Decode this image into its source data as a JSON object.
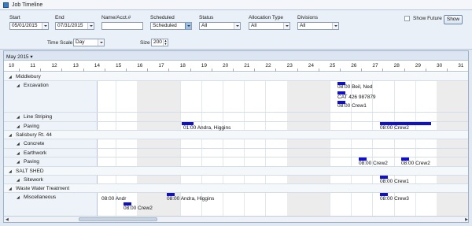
{
  "window": {
    "title": "Job Timeline"
  },
  "filters": {
    "start_label": "Start",
    "start_value": "05/01/2015",
    "end_label": "End",
    "end_value": "07/31/2015",
    "name_label": "Name/Acct.#",
    "name_value": "",
    "scheduled_label": "Scheduled",
    "scheduled_value": "Scheduled",
    "status_label": "Status",
    "status_value": "All",
    "allocation_label": "Allocation Type",
    "allocation_value": "All",
    "divisions_label": "Divisions",
    "divisions_value": "All",
    "show_future_label": "Show Future",
    "show_button": "Show",
    "timescale_label": "Time Scale",
    "timescale_value": "Day",
    "size_label": "Size",
    "size_value": "200"
  },
  "timeline": {
    "month_label": "May 2015",
    "days": [
      "10",
      "11",
      "12",
      "13",
      "14",
      "15",
      "16",
      "17",
      "18",
      "19",
      "20",
      "21",
      "22",
      "23",
      "24",
      "25",
      "26",
      "27",
      "28",
      "29",
      "30",
      "31"
    ],
    "weekend_days": [
      "16",
      "17",
      "23",
      "24",
      "30",
      "31"
    ],
    "rows": [
      {
        "type": "group",
        "label": "Middlebury"
      },
      {
        "type": "task",
        "label": "Excavation",
        "tall": true
      },
      {
        "type": "task",
        "label": "Line Striping"
      },
      {
        "type": "task",
        "label": "Paving"
      },
      {
        "type": "group",
        "label": "Salisbury Rt. 44"
      },
      {
        "type": "task",
        "label": "Concrete"
      },
      {
        "type": "task",
        "label": "Earthwork"
      },
      {
        "type": "task",
        "label": "Paving"
      },
      {
        "type": "group",
        "label": "SALT SHED"
      },
      {
        "type": "task",
        "label": "Sitework"
      },
      {
        "type": "group",
        "label": "Waste Water Treatment"
      },
      {
        "type": "task",
        "label": "Miscellaneous",
        "tall": true
      }
    ],
    "events": {
      "excavation_1": "08:00 Beil, Ned",
      "excavation_2": "CAT 426 987879",
      "excavation_3": "08:00 Crew1",
      "paving_1": "01:00 Andra, Higgins",
      "paving_2": "08:00 Crew2",
      "salisbury_paving_1": "08:00 Crew2",
      "salisbury_paving_2": "08:00 Crew2",
      "sitework_1": "08:00 Crew1",
      "misc_1": "08:00 Andr",
      "misc_2": "08:00 Crew2",
      "misc_3": "08:00 Andra, Higgins",
      "misc_4": "08:00 Crew3"
    }
  },
  "colors": {
    "bar": "#1010c8",
    "header_bg": "#dce6f2"
  }
}
